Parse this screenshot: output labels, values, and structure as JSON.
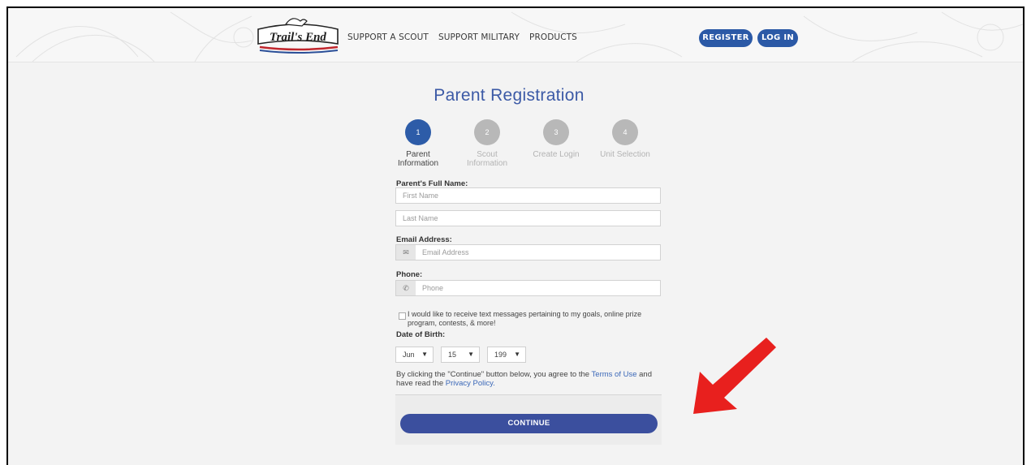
{
  "brand": {
    "logo_text": "Trail's End"
  },
  "nav": {
    "items": [
      "SUPPORT A SCOUT",
      "SUPPORT MILITARY",
      "PRODUCTS"
    ],
    "register": "REGISTER",
    "login": "LOG IN"
  },
  "page": {
    "title": "Parent Registration"
  },
  "steps": [
    {
      "number": "1",
      "label": "Parent Information",
      "active": true
    },
    {
      "number": "2",
      "label": "Scout Information",
      "active": false
    },
    {
      "number": "3",
      "label": "Create Login",
      "active": false
    },
    {
      "number": "4",
      "label": "Unit Selection",
      "active": false
    }
  ],
  "form": {
    "full_name_label": "Parent's Full Name:",
    "first_name_placeholder": "First Name",
    "last_name_placeholder": "Last Name",
    "email_label": "Email Address:",
    "email_placeholder": "Email Address",
    "email_icon": "envelope-icon",
    "phone_label": "Phone:",
    "phone_placeholder": "Phone",
    "phone_icon": "phone-icon",
    "sms_opt_in_text": "I would like to receive text messages pertaining to my goals, online prize program, contests, & more!",
    "sms_opt_in_checked": false,
    "dob_label": "Date of Birth:",
    "dob_month": "Jun",
    "dob_day": "15",
    "dob_year": "199",
    "terms_before": "By clicking the \"Continue\" button below, you agree to the ",
    "terms_link": "Terms of Use",
    "terms_middle": " and have read the ",
    "privacy_link": "Privacy Policy.",
    "continue_label": "CONTINUE"
  },
  "colors": {
    "primary": "#2b59a6",
    "continue": "#3b4f9e",
    "annotation_arrow": "#e8201e"
  }
}
